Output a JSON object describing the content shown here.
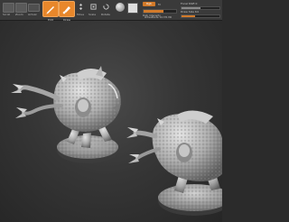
{
  "toolbar": {
    "buttons_left": [
      {
        "label": "Scroll",
        "icon": "scroll-icon"
      },
      {
        "label": "Zoom",
        "icon": "zoom-icon"
      },
      {
        "label": "Actual",
        "icon": "actual-size-icon"
      }
    ],
    "edit_label": "Edit",
    "draw_label": "Draw",
    "move_label": "Move",
    "scale_label": "Scale",
    "rotate_label": "Rotate",
    "rgb_label": "Rgb",
    "intensity_label": "Rgb Intensity",
    "focal_label": "Focal Shift",
    "focal_value": "0",
    "draw_size_label": "Draw Size",
    "draw_size_value": "64",
    "mrgb_label": "M",
    "z_intensity_label": "Z Intensity",
    "z_intensity_value": "25",
    "active_points_label": "ActivePoints:",
    "active_points_value": "10.371 Mil",
    "total_points_label": "TotalPoints:",
    "total_points_value": "10.372 Mil",
    "sliders": {
      "rgb_intensity": 0.6,
      "focal_shift": 0.5,
      "draw_size": 0.35,
      "z_intensity": 0.25
    },
    "colors": {
      "active_tool": "#e8872b",
      "toolbar_bg": "#3a3a3a"
    }
  },
  "viewport": {
    "description_icons": [
      "mech-model-left",
      "mech-model-right"
    ],
    "colors": {
      "background": "#363636",
      "model": "#b8b8b8"
    }
  }
}
